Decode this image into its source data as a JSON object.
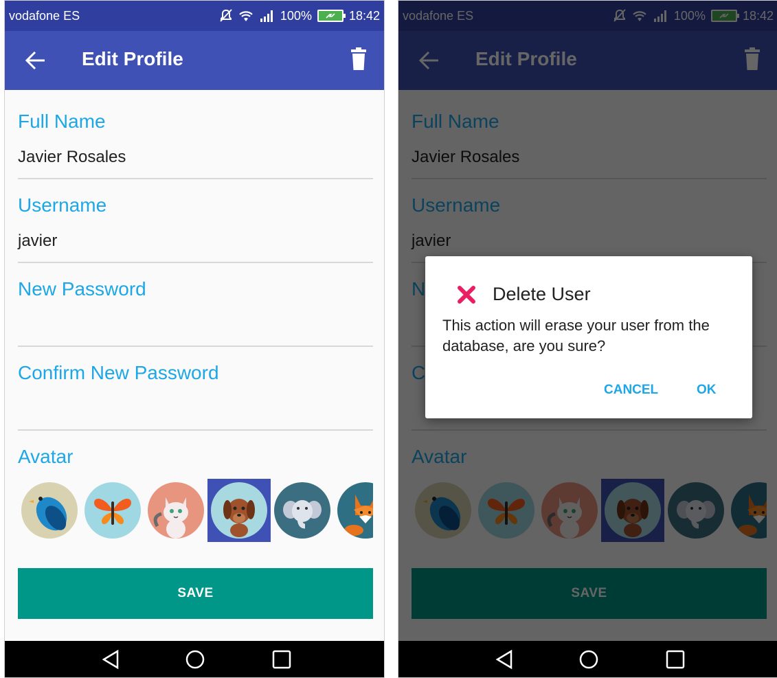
{
  "colors": {
    "toolbar": "#3f51b5",
    "toolbar_dimmed": "#1b2263",
    "status": "#303f9f",
    "accent": "#1ea7e6",
    "save": "#009688",
    "dialog_icon": "#e91e63"
  },
  "status_bar": {
    "carrier": "vodafone ES",
    "battery_percent": "100%",
    "time": "18:42",
    "icons": [
      "mute-icon",
      "wifi-icon",
      "signal-icon",
      "battery-charging-icon"
    ]
  },
  "toolbar": {
    "title": "Edit Profile",
    "back_icon": "arrow-left-icon",
    "delete_icon": "trash-icon"
  },
  "form": {
    "full_name": {
      "label": "Full Name",
      "value": "Javier Rosales"
    },
    "username": {
      "label": "Username",
      "value": "javier"
    },
    "new_password": {
      "label": "New Password",
      "value": ""
    },
    "confirm_password": {
      "label": "Confirm New Password",
      "value": ""
    },
    "avatar": {
      "label": "Avatar",
      "options": [
        "bird",
        "butterfly",
        "cat",
        "dog",
        "elephant",
        "fox"
      ],
      "selected": "dog"
    },
    "save_label": "SAVE"
  },
  "dialog": {
    "icon": "close-x-icon",
    "title": "Delete User",
    "message": "This action will erase your user from the database, are you sure?",
    "cancel_label": "CANCEL",
    "ok_label": "OK"
  },
  "nav_bar": {
    "icons": [
      "back-triangle-icon",
      "home-circle-icon",
      "recents-square-icon"
    ]
  }
}
